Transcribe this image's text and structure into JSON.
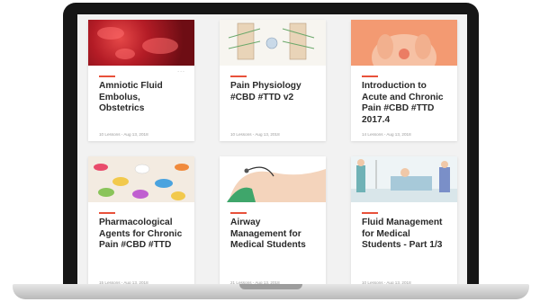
{
  "courses": [
    {
      "title": "Amniotic Fluid Embolus, Obstetrics",
      "meta": "10 Lessons - Aug 13, 2018",
      "thumb": "red-microscopy-image",
      "menu": "..."
    },
    {
      "title": "Pain Physiology #CBD #TTD v2",
      "meta": "10 Lessons - Aug 13, 2018",
      "thumb": "spine-anatomy-diagram"
    },
    {
      "title": "Introduction to Acute and Chronic Pain #CBD #TTD 2017.4",
      "meta": "14 Lessons - Aug 13, 2018",
      "thumb": "back-pain-illustration"
    },
    {
      "title": "Pharmacological Agents for Chronic Pain #CBD #TTD",
      "meta": "15 Lessons - Aug 13, 2018",
      "thumb": "pills-photo"
    },
    {
      "title": "Airway Management for Medical Students",
      "meta": "21 Lessons - Aug 13, 2018",
      "thumb": "airway-intubation-illustration"
    },
    {
      "title": "Fluid Management for Medical Students - Part 1/3",
      "meta": "10 Lessons - Aug 13, 2018",
      "thumb": "hospital-patient-illustration"
    }
  ],
  "colors": {
    "accent": "#e8513a",
    "background": "#f2f2f2",
    "card": "#ffffff",
    "bezel": "#161616"
  }
}
